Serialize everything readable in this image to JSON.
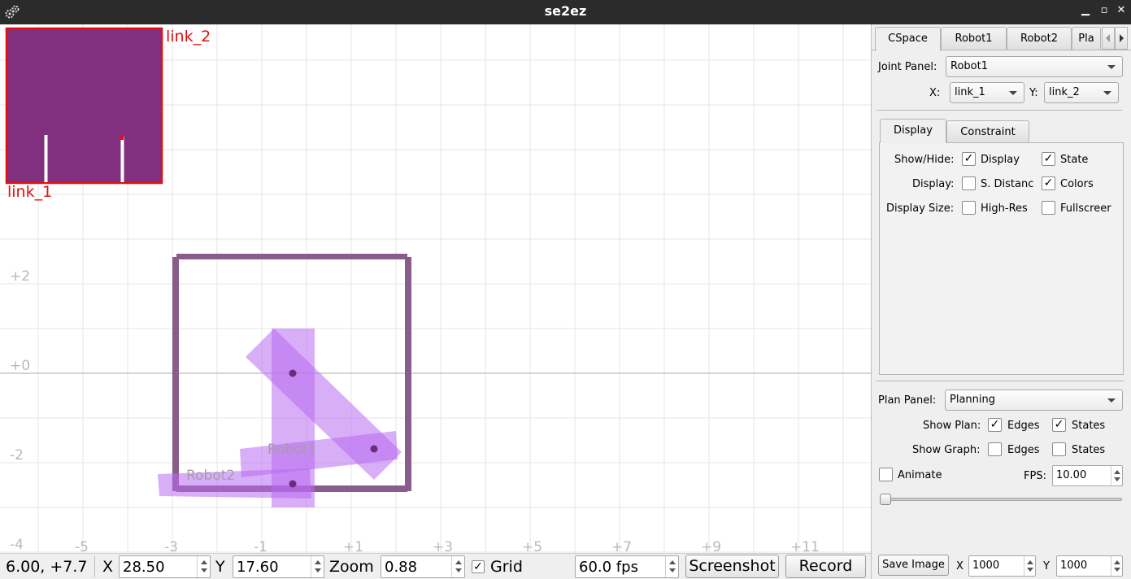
{
  "window": {
    "title": "se2ez"
  },
  "canvas": {
    "overlay": {
      "x_label": "link_1",
      "y_label": "link_2"
    },
    "robot_labels": [
      "Robot1",
      "Robot2"
    ],
    "y_ticks": [
      {
        "value": 2,
        "label": "+2"
      },
      {
        "value": 0,
        "label": "+0"
      },
      {
        "value": -2,
        "label": "-2"
      },
      {
        "value": -4,
        "label": "-4"
      }
    ],
    "x_ticks": [
      {
        "value": -5,
        "label": "-5"
      },
      {
        "value": -3,
        "label": "-3"
      },
      {
        "value": -1,
        "label": "-1"
      },
      {
        "value": 1,
        "label": "+1"
      },
      {
        "value": 3,
        "label": "+3"
      },
      {
        "value": 5,
        "label": "+5"
      },
      {
        "value": 7,
        "label": "+7"
      },
      {
        "value": 9,
        "label": "+9"
      },
      {
        "value": 11,
        "label": "+11"
      }
    ],
    "colors": {
      "cspace_bg": "#81307f",
      "cspace_border": "#e01010",
      "label_red": "#e01010",
      "workspace_box": "#8a5c8c",
      "robot_fill": "#b86cf0",
      "grid": "#e6e6e6",
      "axis": "#d4d4d4",
      "tick_text": "#b9b9b9"
    }
  },
  "bottombar": {
    "coords": "6.00,  +7.7",
    "x_label": "X",
    "x_value": "28.50",
    "y_label": "Y",
    "y_value": "17.60",
    "zoom_label": "Zoom",
    "zoom_value": "0.88",
    "grid_label": "Grid",
    "grid_checked": "✓",
    "fps_value": "60.0 fps",
    "screenshot_label": "Screenshot",
    "record_label": "Record"
  },
  "panel": {
    "tabs": [
      "CSpace",
      "Robot1",
      "Robot2",
      "Pla"
    ],
    "joint_panel_label": "Joint Panel:",
    "joint_panel_value": "Robot1",
    "x_label": "X:",
    "x_value": "link_1",
    "y_label": "Y:",
    "y_value": "link_2",
    "subtabs": [
      "Display",
      "Constraint"
    ],
    "show_hide_label": "Show/Hide:",
    "display_label": "Display:",
    "display_size_label": "Display Size:",
    "cb_display": {
      "label": "Display",
      "mark": "✓"
    },
    "cb_state": {
      "label": "State",
      "mark": "✓"
    },
    "cb_sdist": {
      "label": "S. Distanc",
      "mark": ""
    },
    "cb_colors": {
      "label": "Colors",
      "mark": "✓"
    },
    "cb_highres": {
      "label": "High-Res",
      "mark": ""
    },
    "cb_fullscreen": {
      "label": "Fullscreer",
      "mark": ""
    },
    "plan_panel_label": "Plan Panel:",
    "plan_panel_value": "Planning",
    "show_plan_label": "Show Plan:",
    "show_graph_label": "Show Graph:",
    "plan_edges": {
      "label": "Edges",
      "mark": "✓"
    },
    "plan_states": {
      "label": "States",
      "mark": "✓"
    },
    "graph_edges": {
      "label": "Edges",
      "mark": ""
    },
    "graph_states": {
      "label": "States",
      "mark": ""
    },
    "animate": {
      "label": "Animate",
      "mark": ""
    },
    "fps_label": "FPS:",
    "fps_value": "10.00",
    "animation_progress": 0,
    "save_image_label": "Save Image",
    "save_x_label": "X",
    "save_x_value": "1000",
    "save_y_label": "Y",
    "save_y_value": "1000"
  }
}
